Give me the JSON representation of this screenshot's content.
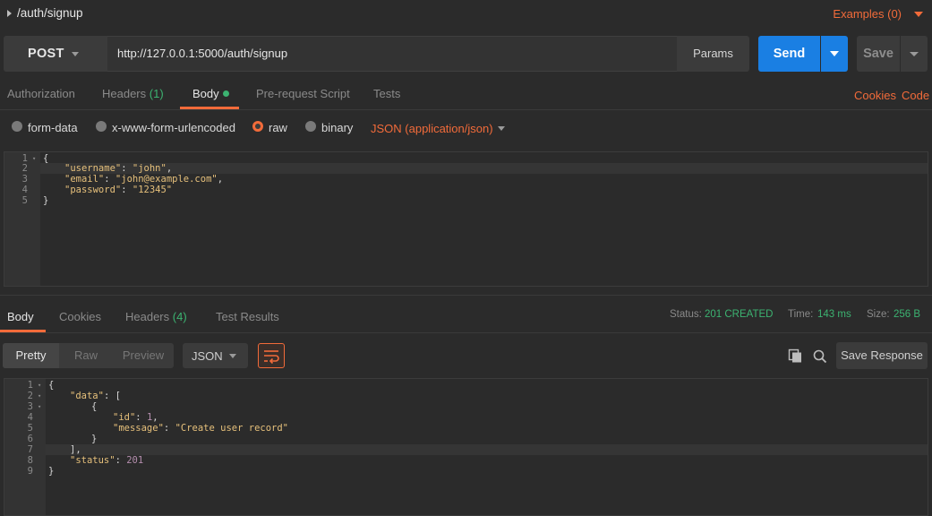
{
  "request": {
    "name": "/auth/signup",
    "examples_label": "Examples (0)",
    "method": "POST",
    "url": "http://127.0.0.1:5000/auth/signup",
    "params_label": "Params",
    "send_label": "Send",
    "save_label": "Save"
  },
  "request_tabs": {
    "authorization": "Authorization",
    "headers": "Headers",
    "headers_count": "(1)",
    "body": "Body",
    "prerequest": "Pre-request Script",
    "tests": "Tests",
    "cookies": "Cookies",
    "code": "Code"
  },
  "body_types": {
    "form_data": "form-data",
    "urlencoded": "x-www-form-urlencoded",
    "raw": "raw",
    "binary": "binary",
    "selected": "raw",
    "content_type": "JSON (application/json)"
  },
  "request_body_lines": [
    {
      "n": "1",
      "text": "{"
    },
    {
      "n": "2",
      "key": "\"username\"",
      "value": "\"john\"",
      "trail": ","
    },
    {
      "n": "3",
      "key": "\"email\"",
      "value": "\"john@example.com\"",
      "trail": ","
    },
    {
      "n": "4",
      "key": "\"password\"",
      "value": "\"12345\"",
      "trail": ""
    },
    {
      "n": "5",
      "text": "}"
    }
  ],
  "response_tabs": {
    "body": "Body",
    "cookies": "Cookies",
    "headers": "Headers",
    "headers_count": "(4)",
    "test_results": "Test Results"
  },
  "response_meta": {
    "status_label": "Status:",
    "status_value": "201 CREATED",
    "time_label": "Time:",
    "time_value": "143 ms",
    "size_label": "Size:",
    "size_value": "256 B"
  },
  "response_toolbar": {
    "pretty": "Pretty",
    "raw": "Raw",
    "preview": "Preview",
    "format": "JSON",
    "save_response": "Save Response"
  },
  "response_body_lines": [
    {
      "n": "1",
      "text": "{"
    },
    {
      "n": "2",
      "key": "\"data\"",
      "text": ": ["
    },
    {
      "n": "3",
      "text": "{"
    },
    {
      "n": "4",
      "key": "\"id\"",
      "num": "1",
      "trail": ","
    },
    {
      "n": "5",
      "key": "\"message\"",
      "value": "\"Create user record\""
    },
    {
      "n": "6",
      "text": "}"
    },
    {
      "n": "7",
      "text": "],"
    },
    {
      "n": "8",
      "key": "\"status\"",
      "num": "201"
    },
    {
      "n": "9",
      "text": "}"
    }
  ],
  "colors": {
    "accent": "#f26b3a",
    "send": "#1a7fe3",
    "success": "#3cb371"
  },
  "icons": [
    "caret-right-icon",
    "chevron-down-icon",
    "wrap-lines-icon",
    "copy-icon",
    "search-icon"
  ]
}
